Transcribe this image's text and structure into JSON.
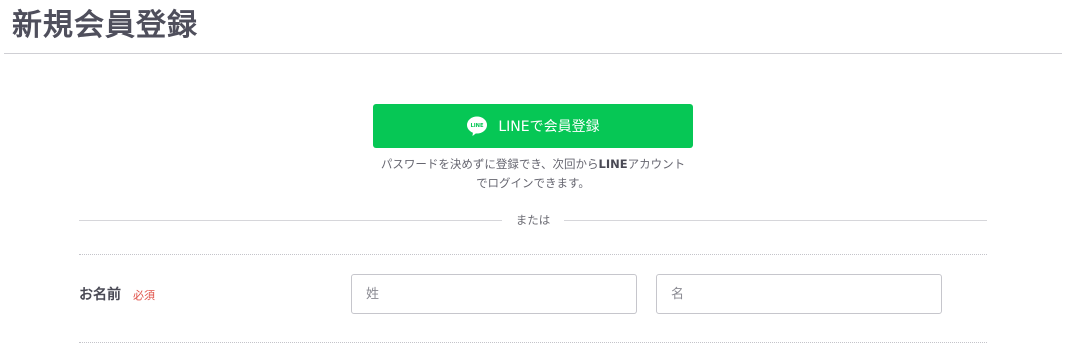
{
  "page": {
    "title": "新規会員登録"
  },
  "line_signup": {
    "button_label": "LINEで会員登録",
    "icon_text": "LINE",
    "note_before": "パスワードを決めずに登録でき、次回から",
    "note_bold": "LINE",
    "note_after_line1": "アカウント",
    "note_line2": "でログインできます。",
    "brand_color": "#06c755"
  },
  "divider": {
    "text": "または"
  },
  "form": {
    "name": {
      "label": "お名前",
      "required_badge": "必須",
      "last_name_placeholder": "姓",
      "first_name_placeholder": "名",
      "last_name_value": "",
      "first_name_value": ""
    }
  },
  "colors": {
    "required": "#e0524a",
    "title": "#4f4f5c"
  }
}
